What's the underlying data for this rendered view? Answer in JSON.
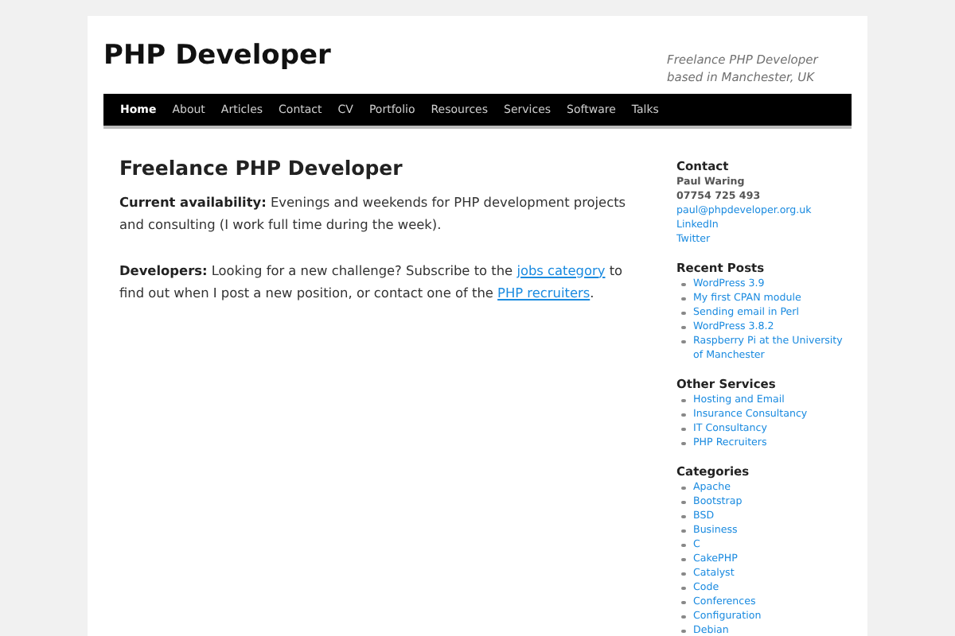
{
  "site": {
    "title": "PHP Developer",
    "tagline": "Freelance PHP Developer based in Manchester, UK"
  },
  "nav": [
    {
      "label": "Home",
      "selected": true
    },
    {
      "label": "About",
      "selected": false
    },
    {
      "label": "Articles",
      "selected": false
    },
    {
      "label": "Contact",
      "selected": false
    },
    {
      "label": "CV",
      "selected": false
    },
    {
      "label": "Portfolio",
      "selected": false
    },
    {
      "label": "Resources",
      "selected": false
    },
    {
      "label": "Services",
      "selected": false
    },
    {
      "label": "Software",
      "selected": false
    },
    {
      "label": "Talks",
      "selected": false
    }
  ],
  "article": {
    "title": "Freelance PHP Developer",
    "paragraphs": [
      {
        "lead": "Current availability:",
        "parts": [
          {
            "text": " Evenings and weekends for PHP development projects and consulting (I work full time during the week)."
          }
        ]
      },
      {
        "lead": "Developers:",
        "parts": [
          {
            "text": " Looking for a new challenge? Subscribe to the "
          },
          {
            "text": "jobs category",
            "link": true
          },
          {
            "text": " to find out when I post a new position, or contact one of the "
          },
          {
            "text": "PHP recruiters",
            "link": true
          },
          {
            "text": "."
          }
        ]
      }
    ]
  },
  "sidebar": [
    {
      "title": "Contact",
      "kind": "contact",
      "items": [
        {
          "text": "Paul Waring",
          "link": false
        },
        {
          "text": "07754 725 493",
          "link": false
        },
        {
          "text": "paul@phpdeveloper.org.uk",
          "link": true
        },
        {
          "text": "LinkedIn",
          "link": true
        },
        {
          "text": "Twitter",
          "link": true
        }
      ]
    },
    {
      "title": "Recent Posts",
      "kind": "list",
      "items": [
        "WordPress 3.9",
        "My first CPAN module",
        "Sending email in Perl",
        "WordPress 3.8.2",
        "Raspberry Pi at the University of Manchester"
      ]
    },
    {
      "title": "Other Services",
      "kind": "list",
      "items": [
        "Hosting and Email",
        "Insurance Consultancy",
        "IT Consultancy",
        "PHP Recruiters"
      ]
    },
    {
      "title": "Categories",
      "kind": "list",
      "items": [
        "Apache",
        "Bootstrap",
        "BSD",
        "Business",
        "C",
        "CakePHP",
        "Catalyst",
        "Code",
        "Conferences",
        "Configuration",
        "Debian"
      ]
    }
  ]
}
